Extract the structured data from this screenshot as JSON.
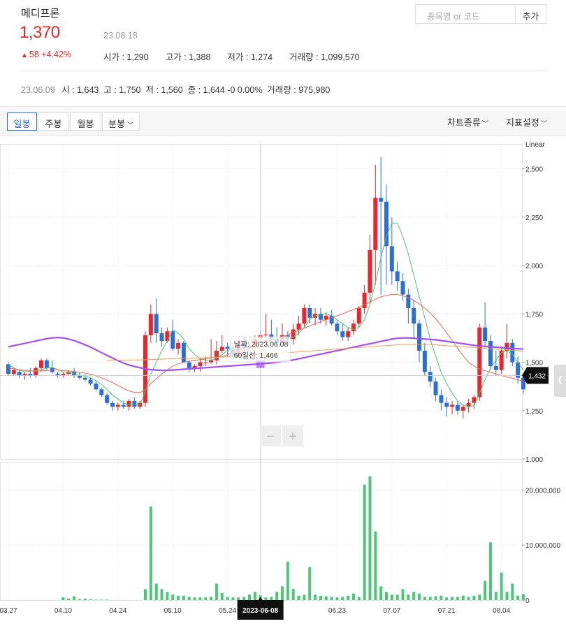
{
  "stock": {
    "name": "메디프론",
    "price": "1,370",
    "change_arrow": "▲",
    "change": "58 +4.42%",
    "date": "23.08.18",
    "open": "시가 : 1,290",
    "high": "고가 : 1,388",
    "low": "저가 : 1,274",
    "volume": "거래량 : 1,099,570"
  },
  "search": {
    "placeholder": "종목명 or 코드",
    "add_label": "추가"
  },
  "prev_day": {
    "date": "23.06.09",
    "open": "시 : 1,643",
    "high": "고 : 1,750",
    "low": "저 : 1,560",
    "close": "종 : 1,644 -0 0.00%",
    "volume": "거래량 : 975,980"
  },
  "toolbar": {
    "tabs": [
      "일봉",
      "주봉",
      "월봉",
      "분봉"
    ],
    "active_tab": "일봉",
    "chart_type": "차트종류",
    "indicator": "지표설정"
  },
  "colors": {
    "up": "#e8262b",
    "down": "#2a6fd6",
    "ma5": "#52c46e",
    "ma20": "#e86a5a",
    "ma60": "#a24ff0",
    "ma120": "#f0a060",
    "volume": "#4cc777"
  },
  "chart_data": [
    {
      "type": "candlestick",
      "yscale_label": "Linear",
      "ylim": [
        1000,
        2625
      ],
      "yticks": [
        1000,
        1250,
        1500,
        1750,
        2000,
        2250,
        2500
      ],
      "ytick_labels": [
        "1,000",
        "1,250",
        "1,500",
        "1,750",
        "2,000",
        "2,250",
        "2,500"
      ],
      "xtick_labels": [
        "03.27",
        "04.10",
        "04.24",
        "05.10",
        "05.24",
        "06.23",
        "07.07",
        "07.21",
        "08.04"
      ],
      "xtick_index": [
        0,
        10,
        20,
        30,
        40,
        60,
        70,
        80,
        90
      ],
      "ohlc": [
        [
          1490,
          1500,
          1430,
          1440
        ],
        [
          1440,
          1470,
          1430,
          1460
        ],
        [
          1450,
          1460,
          1420,
          1430
        ],
        [
          1430,
          1450,
          1410,
          1440
        ],
        [
          1440,
          1470,
          1420,
          1430
        ],
        [
          1430,
          1480,
          1420,
          1470
        ],
        [
          1470,
          1520,
          1450,
          1510
        ],
        [
          1510,
          1520,
          1460,
          1470
        ],
        [
          1470,
          1510,
          1440,
          1450
        ],
        [
          1440,
          1450,
          1420,
          1430
        ],
        [
          1430,
          1450,
          1420,
          1440
        ],
        [
          1440,
          1460,
          1430,
          1450
        ],
        [
          1450,
          1470,
          1420,
          1430
        ],
        [
          1430,
          1450,
          1410,
          1420
        ],
        [
          1420,
          1440,
          1400,
          1410
        ],
        [
          1410,
          1420,
          1380,
          1390
        ],
        [
          1390,
          1400,
          1350,
          1360
        ],
        [
          1360,
          1370,
          1320,
          1330
        ],
        [
          1330,
          1340,
          1280,
          1290
        ],
        [
          1290,
          1300,
          1250,
          1270
        ],
        [
          1270,
          1290,
          1250,
          1280
        ],
        [
          1280,
          1300,
          1260,
          1270
        ],
        [
          1270,
          1310,
          1250,
          1300
        ],
        [
          1300,
          1320,
          1260,
          1270
        ],
        [
          1270,
          1300,
          1260,
          1290
        ],
        [
          1290,
          1660,
          1270,
          1640
        ],
        [
          1640,
          1800,
          1600,
          1750
        ],
        [
          1750,
          1830,
          1600,
          1650
        ],
        [
          1650,
          1680,
          1580,
          1610
        ],
        [
          1610,
          1680,
          1600,
          1660
        ],
        [
          1660,
          1720,
          1560,
          1570
        ],
        [
          1570,
          1620,
          1540,
          1600
        ],
        [
          1600,
          1610,
          1500,
          1500
        ],
        [
          1500,
          1510,
          1450,
          1470
        ],
        [
          1470,
          1490,
          1450,
          1480
        ],
        [
          1480,
          1520,
          1450,
          1500
        ],
        [
          1500,
          1530,
          1480,
          1500
        ],
        [
          1500,
          1620,
          1490,
          1510
        ],
        [
          1510,
          1610,
          1490,
          1560
        ],
        [
          1560,
          1640,
          1550,
          1580
        ],
        [
          1580,
          1600,
          1530,
          1570
        ],
        [
          1570,
          1590,
          1510,
          1530
        ],
        [
          1530,
          1610,
          1520,
          1590
        ],
        [
          1590,
          1630,
          1560,
          1570
        ],
        [
          1570,
          1600,
          1510,
          1580
        ],
        [
          1580,
          1640,
          1550,
          1620
        ],
        [
          1620,
          1660,
          1580,
          1640
        ],
        [
          1640,
          1750,
          1560,
          1644
        ],
        [
          1644,
          1720,
          1600,
          1620
        ],
        [
          1620,
          1680,
          1560,
          1600
        ],
        [
          1600,
          1700,
          1580,
          1640
        ],
        [
          1640,
          1660,
          1580,
          1620
        ],
        [
          1620,
          1700,
          1590,
          1670
        ],
        [
          1670,
          1740,
          1640,
          1700
        ],
        [
          1700,
          1800,
          1680,
          1780
        ],
        [
          1780,
          1800,
          1700,
          1730
        ],
        [
          1730,
          1780,
          1690,
          1750
        ],
        [
          1750,
          1780,
          1700,
          1720
        ],
        [
          1720,
          1760,
          1690,
          1740
        ],
        [
          1740,
          1770,
          1690,
          1700
        ],
        [
          1700,
          1720,
          1640,
          1660
        ],
        [
          1660,
          1700,
          1610,
          1630
        ],
        [
          1630,
          1680,
          1610,
          1660
        ],
        [
          1660,
          1720,
          1640,
          1700
        ],
        [
          1700,
          1790,
          1680,
          1780
        ],
        [
          1780,
          1900,
          1750,
          1860
        ],
        [
          1860,
          2160,
          1800,
          2080
        ],
        [
          2080,
          2520,
          1900,
          2350
        ],
        [
          2350,
          2560,
          1850,
          2330
        ],
        [
          2330,
          2420,
          1900,
          2100
        ],
        [
          2100,
          2250,
          1900,
          1970
        ],
        [
          1970,
          2020,
          1870,
          1920
        ],
        [
          1920,
          1960,
          1820,
          1850
        ],
        [
          1850,
          1880,
          1700,
          1780
        ],
        [
          1780,
          1820,
          1620,
          1700
        ],
        [
          1700,
          1720,
          1500,
          1560
        ],
        [
          1560,
          1600,
          1430,
          1450
        ],
        [
          1450,
          1480,
          1370,
          1400
        ],
        [
          1400,
          1420,
          1300,
          1330
        ],
        [
          1330,
          1360,
          1250,
          1290
        ],
        [
          1290,
          1320,
          1220,
          1270
        ],
        [
          1270,
          1300,
          1230,
          1280
        ],
        [
          1280,
          1300,
          1230,
          1250
        ],
        [
          1250,
          1280,
          1210,
          1270
        ],
        [
          1270,
          1310,
          1240,
          1290
        ],
        [
          1290,
          1330,
          1260,
          1320
        ],
        [
          1320,
          1700,
          1300,
          1680
        ],
        [
          1680,
          1810,
          1580,
          1610
        ],
        [
          1610,
          1640,
          1460,
          1480
        ],
        [
          1480,
          1560,
          1430,
          1460
        ],
        [
          1460,
          1580,
          1440,
          1560
        ],
        [
          1560,
          1700,
          1520,
          1600
        ],
        [
          1600,
          1620,
          1480,
          1500
        ],
        [
          1500,
          1530,
          1390,
          1420
        ],
        [
          1420,
          1440,
          1340,
          1360
        ]
      ],
      "ma": [
        {
          "name": "5",
          "values": [
            1490,
            1470,
            1460,
            1450,
            1455,
            1458,
            1462,
            1470,
            1474,
            1462,
            1450,
            1448,
            1440,
            1435,
            1430,
            1420,
            1405,
            1385,
            1360,
            1330,
            1310,
            1290,
            1280,
            1280,
            1280,
            1350,
            1440,
            1500,
            1560,
            1610,
            1670,
            1650,
            1620,
            1570,
            1540,
            1520,
            1510,
            1510,
            1520,
            1540,
            1560,
            1570,
            1570,
            1570,
            1570,
            1580,
            1600,
            1610,
            1620,
            1620,
            1620,
            1620,
            1630,
            1650,
            1680,
            1720,
            1740,
            1750,
            1750,
            1740,
            1720,
            1700,
            1680,
            1670,
            1680,
            1720,
            1800,
            1910,
            2040,
            2150,
            2220,
            2220,
            2150,
            2060,
            1950,
            1840,
            1730,
            1620,
            1530,
            1450,
            1390,
            1340,
            1300,
            1280,
            1270,
            1275,
            1340,
            1410,
            1470,
            1510,
            1550,
            1560,
            1540,
            1500,
            1460
          ]
        },
        {
          "name": "20",
          "values": [
            1470,
            1466,
            1462,
            1458,
            1455,
            1455,
            1456,
            1458,
            1460,
            1460,
            1458,
            1455,
            1452,
            1448,
            1444,
            1438,
            1430,
            1420,
            1408,
            1395,
            1380,
            1365,
            1352,
            1345,
            1342,
            1360,
            1390,
            1415,
            1440,
            1460,
            1480,
            1492,
            1500,
            1505,
            1510,
            1514,
            1518,
            1522,
            1526,
            1530,
            1540,
            1550,
            1560,
            1570,
            1580,
            1590,
            1600,
            1608,
            1614,
            1620,
            1630,
            1642,
            1655,
            1666,
            1676,
            1688,
            1700,
            1710,
            1720,
            1730,
            1740,
            1750,
            1762,
            1772,
            1784,
            1798,
            1812,
            1826,
            1838,
            1846,
            1850,
            1850,
            1844,
            1834,
            1820,
            1802,
            1780,
            1754,
            1724,
            1690,
            1652,
            1612,
            1572,
            1534,
            1500,
            1480,
            1466,
            1456,
            1448,
            1440,
            1432,
            1424,
            1418,
            1410,
            1402
          ]
        },
        {
          "name": "60",
          "values": [
            1580,
            1586,
            1592,
            1598,
            1604,
            1610,
            1616,
            1622,
            1626,
            1628,
            1626,
            1620,
            1612,
            1602,
            1590,
            1578,
            1564,
            1550,
            1536,
            1522,
            1508,
            1496,
            1486,
            1478,
            1472,
            1466,
            1462,
            1460,
            1458,
            1458,
            1460,
            1462,
            1464,
            1466,
            1468,
            1470,
            1472,
            1474,
            1476,
            1478,
            1480,
            1482,
            1484,
            1486,
            1488,
            1490,
            1492,
            1494,
            1496,
            1500,
            1504,
            1508,
            1512,
            1518,
            1524,
            1530,
            1536,
            1542,
            1548,
            1554,
            1560,
            1566,
            1572,
            1578,
            1584,
            1590,
            1596,
            1602,
            1608,
            1614,
            1620,
            1624,
            1626,
            1626,
            1624,
            1622,
            1620,
            1618,
            1616,
            1612,
            1608,
            1604,
            1600,
            1596,
            1592,
            1588,
            1584,
            1582,
            1580,
            1578,
            1576,
            1574,
            1572,
            1570,
            1568
          ]
        },
        {
          "name": "120",
          "values": [
            null,
            null,
            null,
            null,
            null,
            null,
            null,
            null,
            null,
            null,
            null,
            null,
            null,
            null,
            null,
            null,
            null,
            null,
            1510,
            1510,
            1510,
            1511,
            1511,
            1512,
            1512,
            1513,
            1514,
            1515,
            1516,
            1517,
            1518,
            1519,
            1520,
            1521,
            1522,
            1523,
            1524,
            1525,
            1526,
            1527,
            1528,
            1530,
            1532,
            1534,
            1536,
            1538,
            1540,
            1542,
            1544,
            1546,
            1548,
            1550,
            1552,
            1554,
            1556,
            1558,
            1560,
            1562,
            1564,
            1566,
            1568,
            1570,
            1572,
            1574,
            1576,
            1578,
            1580,
            1582,
            1584,
            1586,
            1588,
            1590,
            1591,
            1592,
            1592,
            1592,
            1592,
            1591,
            1590,
            1588,
            1586,
            1584,
            1582,
            1580,
            1578,
            1576,
            1574,
            1572,
            1570,
            1568,
            1566,
            1564,
            1562,
            1560,
            1558
          ]
        }
      ],
      "current_value_label": "1,432",
      "current_value": 1432,
      "crosshair_index": 46,
      "tooltip": {
        "date": "날짜: 2023.06.08",
        "ma60": "60일선: 1,466"
      },
      "zoom_minus": "−",
      "zoom_plus": "+"
    },
    {
      "type": "bar",
      "title": "volume",
      "ylim": [
        0,
        25000000
      ],
      "yticks": [
        0,
        10000000,
        20000000
      ],
      "ytick_labels": [
        "0",
        "10,000,000",
        "20,000,000"
      ],
      "values": [
        0,
        0,
        0,
        0,
        0,
        0,
        0,
        0,
        0,
        0,
        500000,
        300000,
        700000,
        200000,
        300000,
        200000,
        100000,
        100000,
        100000,
        0,
        0,
        0,
        0,
        0,
        0,
        2000000,
        17000000,
        3000000,
        2000000,
        1500000,
        1000000,
        800000,
        800000,
        600000,
        500000,
        500000,
        500000,
        600000,
        3000000,
        1300000,
        600000,
        500000,
        500000,
        600000,
        1000000,
        1500000,
        900000,
        500000,
        600000,
        1500000,
        2500000,
        7000000,
        2000000,
        800000,
        1000000,
        6000000,
        1000000,
        800000,
        700000,
        600000,
        500000,
        600000,
        800000,
        1200000,
        600000,
        21000000,
        22500000,
        12500000,
        2500000,
        1500000,
        1000000,
        1000000,
        2000000,
        1000000,
        1500000,
        1200000,
        600000,
        600000,
        700000,
        800000,
        500000,
        600000,
        600000,
        800000,
        600000,
        800000,
        1000000,
        3500000,
        10500000,
        1500000,
        5000000,
        1500000,
        3000000,
        800000,
        1100000
      ],
      "crosshair_date_label": "2023-06-08"
    }
  ]
}
